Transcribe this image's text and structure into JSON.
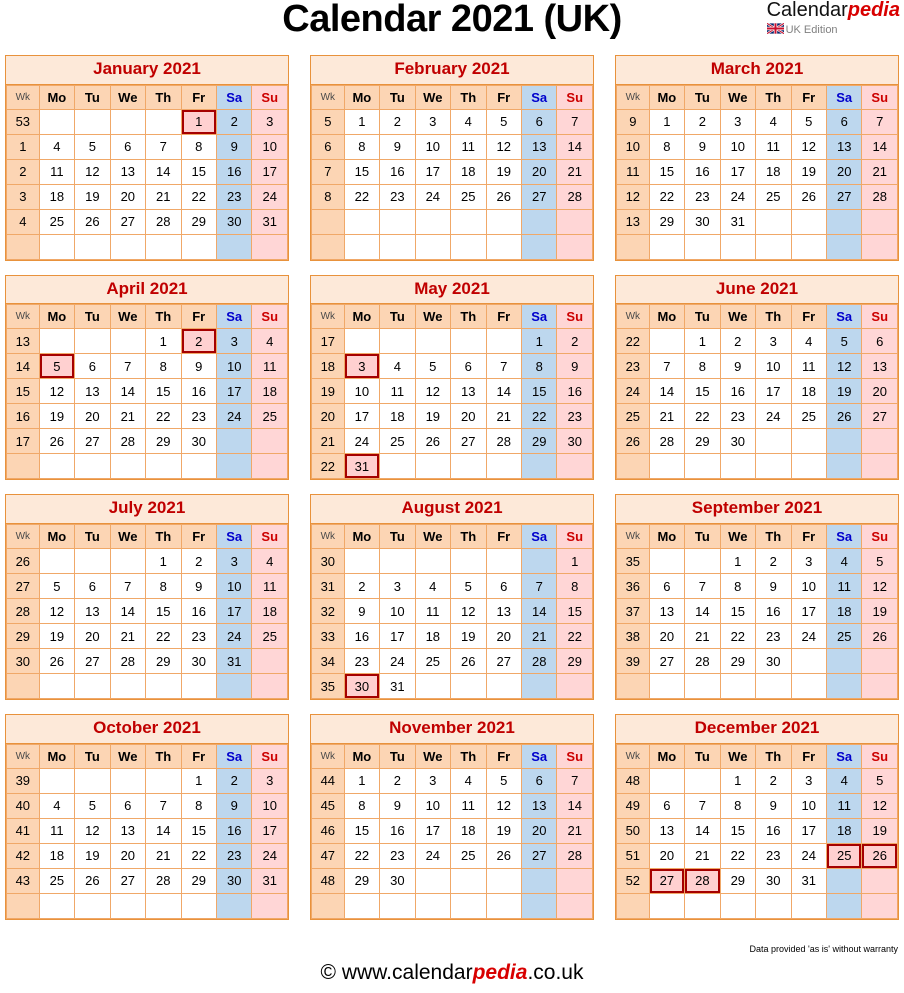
{
  "header": {
    "title": "Calendar 2021 (UK)",
    "brand_calendar": "Calendar",
    "brand_pedia": "pedia",
    "brand_edition": "UK Edition",
    "flag_icon": "uk-flag-icon"
  },
  "weekday_headers": [
    "Wk",
    "Mo",
    "Tu",
    "We",
    "Th",
    "Fr",
    "Sa",
    "Su"
  ],
  "colors": {
    "title_text": "#c00000",
    "title_bg": "#fde9d9",
    "header_bg": "#fcd5b4",
    "border": "#e8923c",
    "cell_border": "#f0a868",
    "saturday_bg": "#bdd7ee",
    "saturday_text": "#0000cc",
    "sunday_bg": "#ffd6d6",
    "sunday_text": "#cc0000",
    "holiday_bg": "#ffd0d0",
    "holiday_border": "#a50000",
    "brand_red": "#d80000"
  },
  "footer": {
    "disclaimer": "Data provided 'as is' without warranty",
    "copyright_prefix": "© www.calendar",
    "copyright_pedia": "pedia",
    "copyright_suffix": ".co.uk"
  },
  "months": [
    {
      "name": "January 2021",
      "weeks": [
        {
          "wk": "53",
          "days": [
            "",
            "",
            "",
            "",
            "1",
            "2",
            "3"
          ],
          "holidays": [
            4
          ]
        },
        {
          "wk": "1",
          "days": [
            "4",
            "5",
            "6",
            "7",
            "8",
            "9",
            "10"
          ],
          "holidays": []
        },
        {
          "wk": "2",
          "days": [
            "11",
            "12",
            "13",
            "14",
            "15",
            "16",
            "17"
          ],
          "holidays": []
        },
        {
          "wk": "3",
          "days": [
            "18",
            "19",
            "20",
            "21",
            "22",
            "23",
            "24"
          ],
          "holidays": []
        },
        {
          "wk": "4",
          "days": [
            "25",
            "26",
            "27",
            "28",
            "29",
            "30",
            "31"
          ],
          "holidays": []
        },
        {
          "wk": "",
          "days": [
            "",
            "",
            "",
            "",
            "",
            "",
            ""
          ],
          "holidays": []
        }
      ]
    },
    {
      "name": "February 2021",
      "weeks": [
        {
          "wk": "5",
          "days": [
            "1",
            "2",
            "3",
            "4",
            "5",
            "6",
            "7"
          ],
          "holidays": []
        },
        {
          "wk": "6",
          "days": [
            "8",
            "9",
            "10",
            "11",
            "12",
            "13",
            "14"
          ],
          "holidays": []
        },
        {
          "wk": "7",
          "days": [
            "15",
            "16",
            "17",
            "18",
            "19",
            "20",
            "21"
          ],
          "holidays": []
        },
        {
          "wk": "8",
          "days": [
            "22",
            "23",
            "24",
            "25",
            "26",
            "27",
            "28"
          ],
          "holidays": []
        },
        {
          "wk": "",
          "days": [
            "",
            "",
            "",
            "",
            "",
            "",
            ""
          ],
          "holidays": []
        },
        {
          "wk": "",
          "days": [
            "",
            "",
            "",
            "",
            "",
            "",
            ""
          ],
          "holidays": []
        }
      ]
    },
    {
      "name": "March 2021",
      "weeks": [
        {
          "wk": "9",
          "days": [
            "1",
            "2",
            "3",
            "4",
            "5",
            "6",
            "7"
          ],
          "holidays": []
        },
        {
          "wk": "10",
          "days": [
            "8",
            "9",
            "10",
            "11",
            "12",
            "13",
            "14"
          ],
          "holidays": []
        },
        {
          "wk": "11",
          "days": [
            "15",
            "16",
            "17",
            "18",
            "19",
            "20",
            "21"
          ],
          "holidays": []
        },
        {
          "wk": "12",
          "days": [
            "22",
            "23",
            "24",
            "25",
            "26",
            "27",
            "28"
          ],
          "holidays": []
        },
        {
          "wk": "13",
          "days": [
            "29",
            "30",
            "31",
            "",
            "",
            "",
            ""
          ],
          "holidays": []
        },
        {
          "wk": "",
          "days": [
            "",
            "",
            "",
            "",
            "",
            "",
            ""
          ],
          "holidays": []
        }
      ]
    },
    {
      "name": "April 2021",
      "weeks": [
        {
          "wk": "13",
          "days": [
            "",
            "",
            "",
            "1",
            "2",
            "3",
            "4"
          ],
          "holidays": [
            4
          ]
        },
        {
          "wk": "14",
          "days": [
            "5",
            "6",
            "7",
            "8",
            "9",
            "10",
            "11"
          ],
          "holidays": [
            0
          ]
        },
        {
          "wk": "15",
          "days": [
            "12",
            "13",
            "14",
            "15",
            "16",
            "17",
            "18"
          ],
          "holidays": []
        },
        {
          "wk": "16",
          "days": [
            "19",
            "20",
            "21",
            "22",
            "23",
            "24",
            "25"
          ],
          "holidays": []
        },
        {
          "wk": "17",
          "days": [
            "26",
            "27",
            "28",
            "29",
            "30",
            "",
            ""
          ],
          "holidays": []
        },
        {
          "wk": "",
          "days": [
            "",
            "",
            "",
            "",
            "",
            "",
            ""
          ],
          "holidays": []
        }
      ]
    },
    {
      "name": "May 2021",
      "weeks": [
        {
          "wk": "17",
          "days": [
            "",
            "",
            "",
            "",
            "",
            "1",
            "2"
          ],
          "holidays": []
        },
        {
          "wk": "18",
          "days": [
            "3",
            "4",
            "5",
            "6",
            "7",
            "8",
            "9"
          ],
          "holidays": [
            0
          ]
        },
        {
          "wk": "19",
          "days": [
            "10",
            "11",
            "12",
            "13",
            "14",
            "15",
            "16"
          ],
          "holidays": []
        },
        {
          "wk": "20",
          "days": [
            "17",
            "18",
            "19",
            "20",
            "21",
            "22",
            "23"
          ],
          "holidays": []
        },
        {
          "wk": "21",
          "days": [
            "24",
            "25",
            "26",
            "27",
            "28",
            "29",
            "30"
          ],
          "holidays": []
        },
        {
          "wk": "22",
          "days": [
            "31",
            "",
            "",
            "",
            "",
            "",
            ""
          ],
          "holidays": [
            0
          ]
        }
      ]
    },
    {
      "name": "June 2021",
      "weeks": [
        {
          "wk": "22",
          "days": [
            "",
            "1",
            "2",
            "3",
            "4",
            "5",
            "6"
          ],
          "holidays": []
        },
        {
          "wk": "23",
          "days": [
            "7",
            "8",
            "9",
            "10",
            "11",
            "12",
            "13"
          ],
          "holidays": []
        },
        {
          "wk": "24",
          "days": [
            "14",
            "15",
            "16",
            "17",
            "18",
            "19",
            "20"
          ],
          "holidays": []
        },
        {
          "wk": "25",
          "days": [
            "21",
            "22",
            "23",
            "24",
            "25",
            "26",
            "27"
          ],
          "holidays": []
        },
        {
          "wk": "26",
          "days": [
            "28",
            "29",
            "30",
            "",
            "",
            "",
            ""
          ],
          "holidays": []
        },
        {
          "wk": "",
          "days": [
            "",
            "",
            "",
            "",
            "",
            "",
            ""
          ],
          "holidays": []
        }
      ]
    },
    {
      "name": "July 2021",
      "weeks": [
        {
          "wk": "26",
          "days": [
            "",
            "",
            "",
            "1",
            "2",
            "3",
            "4"
          ],
          "holidays": []
        },
        {
          "wk": "27",
          "days": [
            "5",
            "6",
            "7",
            "8",
            "9",
            "10",
            "11"
          ],
          "holidays": []
        },
        {
          "wk": "28",
          "days": [
            "12",
            "13",
            "14",
            "15",
            "16",
            "17",
            "18"
          ],
          "holidays": []
        },
        {
          "wk": "29",
          "days": [
            "19",
            "20",
            "21",
            "22",
            "23",
            "24",
            "25"
          ],
          "holidays": []
        },
        {
          "wk": "30",
          "days": [
            "26",
            "27",
            "28",
            "29",
            "30",
            "31",
            ""
          ],
          "holidays": []
        },
        {
          "wk": "",
          "days": [
            "",
            "",
            "",
            "",
            "",
            "",
            ""
          ],
          "holidays": []
        }
      ]
    },
    {
      "name": "August 2021",
      "weeks": [
        {
          "wk": "30",
          "days": [
            "",
            "",
            "",
            "",
            "",
            "",
            "1"
          ],
          "holidays": []
        },
        {
          "wk": "31",
          "days": [
            "2",
            "3",
            "4",
            "5",
            "6",
            "7",
            "8"
          ],
          "holidays": []
        },
        {
          "wk": "32",
          "days": [
            "9",
            "10",
            "11",
            "12",
            "13",
            "14",
            "15"
          ],
          "holidays": []
        },
        {
          "wk": "33",
          "days": [
            "16",
            "17",
            "18",
            "19",
            "20",
            "21",
            "22"
          ],
          "holidays": []
        },
        {
          "wk": "34",
          "days": [
            "23",
            "24",
            "25",
            "26",
            "27",
            "28",
            "29"
          ],
          "holidays": []
        },
        {
          "wk": "35",
          "days": [
            "30",
            "31",
            "",
            "",
            "",
            "",
            ""
          ],
          "holidays": [
            0
          ]
        }
      ]
    },
    {
      "name": "September 2021",
      "weeks": [
        {
          "wk": "35",
          "days": [
            "",
            "",
            "1",
            "2",
            "3",
            "4",
            "5"
          ],
          "holidays": []
        },
        {
          "wk": "36",
          "days": [
            "6",
            "7",
            "8",
            "9",
            "10",
            "11",
            "12"
          ],
          "holidays": []
        },
        {
          "wk": "37",
          "days": [
            "13",
            "14",
            "15",
            "16",
            "17",
            "18",
            "19"
          ],
          "holidays": []
        },
        {
          "wk": "38",
          "days": [
            "20",
            "21",
            "22",
            "23",
            "24",
            "25",
            "26"
          ],
          "holidays": []
        },
        {
          "wk": "39",
          "days": [
            "27",
            "28",
            "29",
            "30",
            "",
            "",
            ""
          ],
          "holidays": []
        },
        {
          "wk": "",
          "days": [
            "",
            "",
            "",
            "",
            "",
            "",
            ""
          ],
          "holidays": []
        }
      ]
    },
    {
      "name": "October 2021",
      "weeks": [
        {
          "wk": "39",
          "days": [
            "",
            "",
            "",
            "",
            "1",
            "2",
            "3"
          ],
          "holidays": []
        },
        {
          "wk": "40",
          "days": [
            "4",
            "5",
            "6",
            "7",
            "8",
            "9",
            "10"
          ],
          "holidays": []
        },
        {
          "wk": "41",
          "days": [
            "11",
            "12",
            "13",
            "14",
            "15",
            "16",
            "17"
          ],
          "holidays": []
        },
        {
          "wk": "42",
          "days": [
            "18",
            "19",
            "20",
            "21",
            "22",
            "23",
            "24"
          ],
          "holidays": []
        },
        {
          "wk": "43",
          "days": [
            "25",
            "26",
            "27",
            "28",
            "29",
            "30",
            "31"
          ],
          "holidays": []
        },
        {
          "wk": "",
          "days": [
            "",
            "",
            "",
            "",
            "",
            "",
            ""
          ],
          "holidays": []
        }
      ]
    },
    {
      "name": "November 2021",
      "weeks": [
        {
          "wk": "44",
          "days": [
            "1",
            "2",
            "3",
            "4",
            "5",
            "6",
            "7"
          ],
          "holidays": []
        },
        {
          "wk": "45",
          "days": [
            "8",
            "9",
            "10",
            "11",
            "12",
            "13",
            "14"
          ],
          "holidays": []
        },
        {
          "wk": "46",
          "days": [
            "15",
            "16",
            "17",
            "18",
            "19",
            "20",
            "21"
          ],
          "holidays": []
        },
        {
          "wk": "47",
          "days": [
            "22",
            "23",
            "24",
            "25",
            "26",
            "27",
            "28"
          ],
          "holidays": []
        },
        {
          "wk": "48",
          "days": [
            "29",
            "30",
            "",
            "",
            "",
            "",
            ""
          ],
          "holidays": []
        },
        {
          "wk": "",
          "days": [
            "",
            "",
            "",
            "",
            "",
            "",
            ""
          ],
          "holidays": []
        }
      ]
    },
    {
      "name": "December 2021",
      "weeks": [
        {
          "wk": "48",
          "days": [
            "",
            "",
            "1",
            "2",
            "3",
            "4",
            "5"
          ],
          "holidays": []
        },
        {
          "wk": "49",
          "days": [
            "6",
            "7",
            "8",
            "9",
            "10",
            "11",
            "12"
          ],
          "holidays": []
        },
        {
          "wk": "50",
          "days": [
            "13",
            "14",
            "15",
            "16",
            "17",
            "18",
            "19"
          ],
          "holidays": []
        },
        {
          "wk": "51",
          "days": [
            "20",
            "21",
            "22",
            "23",
            "24",
            "25",
            "26"
          ],
          "holidays": [
            5,
            6
          ]
        },
        {
          "wk": "52",
          "days": [
            "27",
            "28",
            "29",
            "30",
            "31",
            "",
            ""
          ],
          "holidays": [
            0,
            1
          ]
        },
        {
          "wk": "",
          "days": [
            "",
            "",
            "",
            "",
            "",
            "",
            ""
          ],
          "holidays": []
        }
      ]
    }
  ]
}
